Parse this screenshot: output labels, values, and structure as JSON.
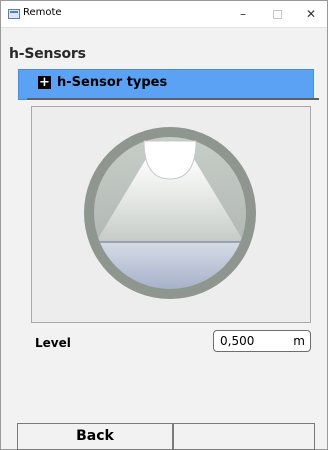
{
  "window": {
    "title": "Remote"
  },
  "window_controls": {
    "minimize": "–",
    "close": "✕"
  },
  "page": {
    "title": "h-Sensors"
  },
  "section": {
    "expand_glyph": "+",
    "label": "h-Sensor types"
  },
  "level": {
    "label": "Level",
    "value": "0,500",
    "unit": "m"
  },
  "buttons": {
    "back": "Back",
    "empty": ""
  },
  "icons": [
    "app-icon",
    "plus-icon",
    "sensor-illustration"
  ],
  "colors": {
    "header_blue": "#5ba2f5",
    "sensor_ring": "#8f958f"
  }
}
